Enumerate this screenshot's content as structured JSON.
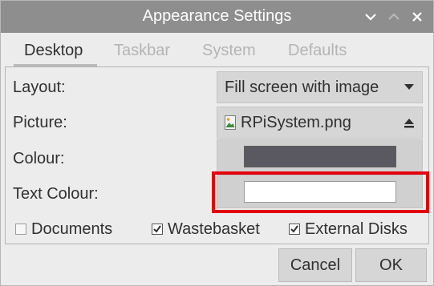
{
  "window": {
    "title": "Appearance Settings"
  },
  "titlebar_buttons": {
    "minimize_icon": "chevron-down-icon",
    "maximize_icon": "chevron-up-icon",
    "close_icon": "close-icon"
  },
  "tabs": [
    {
      "label": "Desktop",
      "active": true
    },
    {
      "label": "Taskbar",
      "active": false
    },
    {
      "label": "System",
      "active": false
    },
    {
      "label": "Defaults",
      "active": false
    }
  ],
  "desktop": {
    "layout": {
      "label": "Layout:",
      "value": "Fill screen with image"
    },
    "picture": {
      "label": "Picture:",
      "value": "RPiSystem.png",
      "file_icon": "image-file-icon",
      "action_icon": "eject-icon"
    },
    "colour": {
      "label": "Colour:",
      "value_color": "#5a5860"
    },
    "text_colour": {
      "label": "Text Colour:",
      "value_color": "#ffffff"
    },
    "checkboxes": [
      {
        "label": "Documents",
        "checked": false
      },
      {
        "label": "Wastebasket",
        "checked": true
      },
      {
        "label": "External Disks",
        "checked": true
      }
    ]
  },
  "buttons": {
    "cancel": "Cancel",
    "ok": "OK"
  },
  "colors": {
    "titlebar": "#8e8e8e",
    "highlight": "#e3000d",
    "window_bg": "#ececec"
  }
}
